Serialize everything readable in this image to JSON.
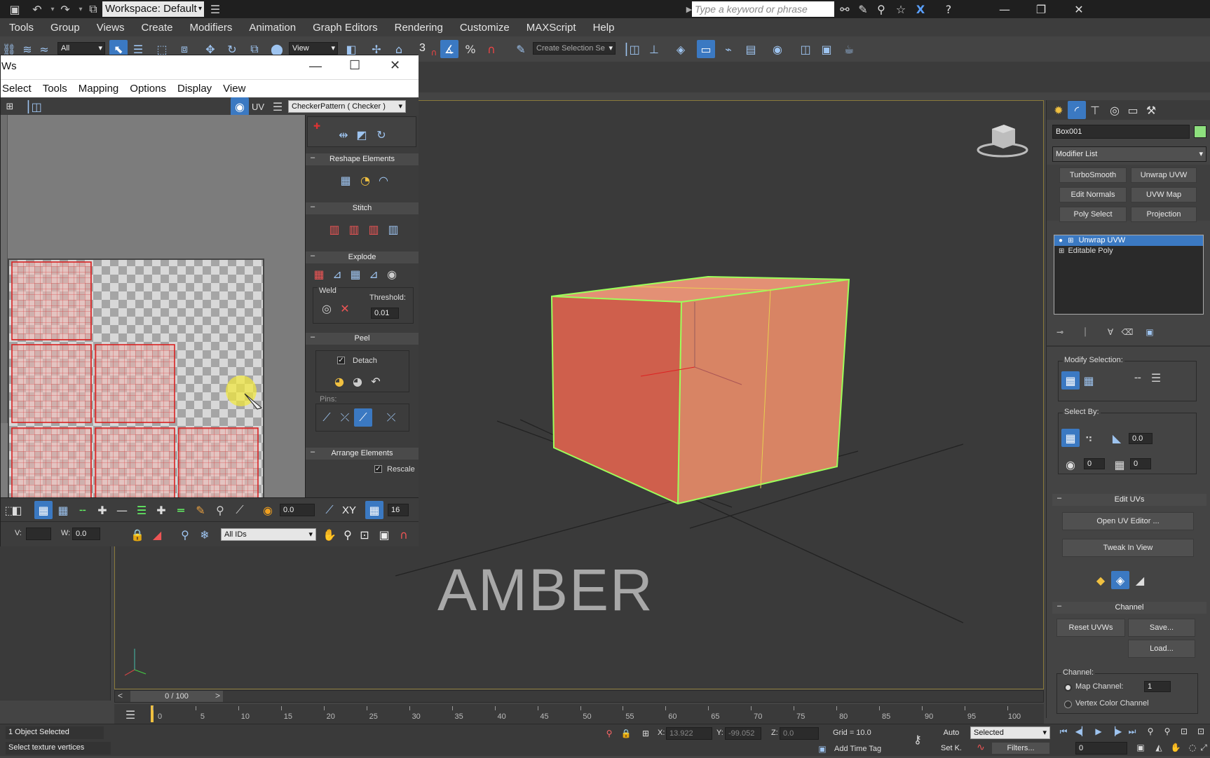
{
  "titlebar": {
    "workspace": "Workspace: Default",
    "search_placeholder": "Type a keyword or phrase"
  },
  "menu": [
    "Tools",
    "Group",
    "Views",
    "Create",
    "Modifiers",
    "Animation",
    "Graph Editors",
    "Rendering",
    "Customize",
    "MAXScript",
    "Help"
  ],
  "toolbar": {
    "filter": "All",
    "ref_coord": "View",
    "selset_placeholder": "Create Selection Se",
    "snap_num": "3"
  },
  "uv_window": {
    "title": "Ws",
    "menu": [
      "Select",
      "Tools",
      "Mapping",
      "Options",
      "Display",
      "View"
    ],
    "uv_label": "UV",
    "pattern": "CheckerPattern  ( Checker )",
    "panels": {
      "reshape": "Reshape Elements",
      "stitch": "Stitch",
      "explode": "Explode",
      "weld": "Weld",
      "threshold_label": "Threshold:",
      "threshold": "0.01",
      "peel": "Peel",
      "detach": "Detach",
      "pins": "Pins:",
      "arrange": "Arrange Elements",
      "rescale": "Rescale",
      "minus": "–"
    },
    "bottom": {
      "value1": "0.0",
      "xy": "XY",
      "grid_num": "16",
      "v_label": "V:",
      "w_label": "W:",
      "w_value": "0.0",
      "ids": "All IDs"
    }
  },
  "viewport": {
    "watermark": "AMBER"
  },
  "command_panel": {
    "object_name": "Box001",
    "object_color": "#8ee07e",
    "modifier_list": "Modifier List",
    "buttons": [
      "TurboSmooth",
      "Unwrap UVW",
      "Edit Normals",
      "UVW Map",
      "Poly Select",
      "Projection"
    ],
    "stack": [
      "Unwrap UVW",
      "Editable Poly"
    ],
    "modify_selection": "Modify Selection:",
    "select_by": "Select By:",
    "sel_val1": "0.0",
    "sel_val2": "0",
    "sel_val3": "0",
    "edit_uvs": "Edit UVs",
    "open_uv_editor": "Open UV Editor ...",
    "tweak_in_view": "Tweak In View",
    "channel": "Channel",
    "reset_uvws": "Reset UVWs",
    "save": "Save...",
    "load": "Load...",
    "channel_label": "Channel:",
    "map_channel": "Map Channel:",
    "map_channel_value": "1",
    "vertex_color_channel": "Vertex Color Channel"
  },
  "timeline": {
    "counter": "0 / 100",
    "ticks": [
      "0",
      "5",
      "10",
      "15",
      "20",
      "25",
      "30",
      "35",
      "40",
      "45",
      "50",
      "55",
      "60",
      "65",
      "70",
      "75",
      "80",
      "85",
      "90",
      "95",
      "100"
    ]
  },
  "status": {
    "selected": "1 Object Selected",
    "prompt": "Select texture vertices",
    "x_label": "X:",
    "x": "13.922",
    "y_label": "Y:",
    "y": "-99.052",
    "z_label": "Z:",
    "z": "0.0",
    "grid": "Grid = 10.0",
    "auto": "Auto",
    "selected_dd": "Selected",
    "set_key": "Set K.",
    "filters": "Filters...",
    "add_time_tag": "Add Time Tag",
    "frame": "0"
  },
  "colors": {
    "accent": "#3b79c2",
    "face_left": "#cf5f4c",
    "face_top": "#e39075",
    "face_right": "#d88464",
    "edge": "#9cff5a",
    "uv_red": "#d82222"
  }
}
